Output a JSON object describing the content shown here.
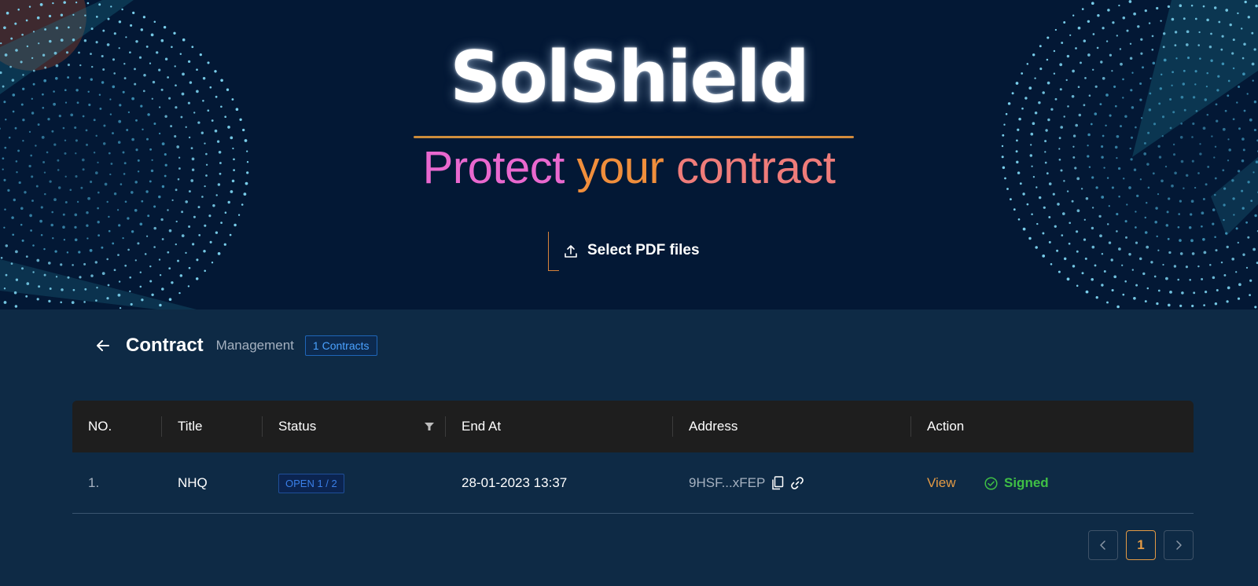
{
  "hero": {
    "brand": "SolShield",
    "tagline_word1": "Protect",
    "tagline_word2": "your",
    "tagline_word3": "contract",
    "upload_label": "Select PDF files"
  },
  "header": {
    "title": "Contract",
    "subtitle": "Management",
    "count_badge": "1 Contracts"
  },
  "table": {
    "columns": {
      "no": "NO.",
      "title": "Title",
      "status": "Status",
      "end_at": "End At",
      "address": "Address",
      "action": "Action"
    },
    "rows": [
      {
        "no": "1.",
        "title": "NHQ",
        "status": "OPEN 1 / 2",
        "end_at": "28-01-2023 13:37",
        "address": "9HSF...xFEP",
        "view_label": "View",
        "signed_label": "Signed"
      }
    ]
  },
  "pagination": {
    "current_page": "1"
  },
  "colors": {
    "hero_bg": "#031835",
    "page_bg": "#0e2a45",
    "accent_orange": "#e39a45",
    "status_blue": "#3a7fe8",
    "signed_green": "#3fbf45"
  },
  "icons": {
    "upload": "upload-icon",
    "back": "arrow-left-icon",
    "filter": "filter-icon",
    "copy": "copy-icon",
    "link": "link-icon",
    "check": "check-circle-icon",
    "prev": "chevron-left-icon",
    "next": "chevron-right-icon"
  }
}
